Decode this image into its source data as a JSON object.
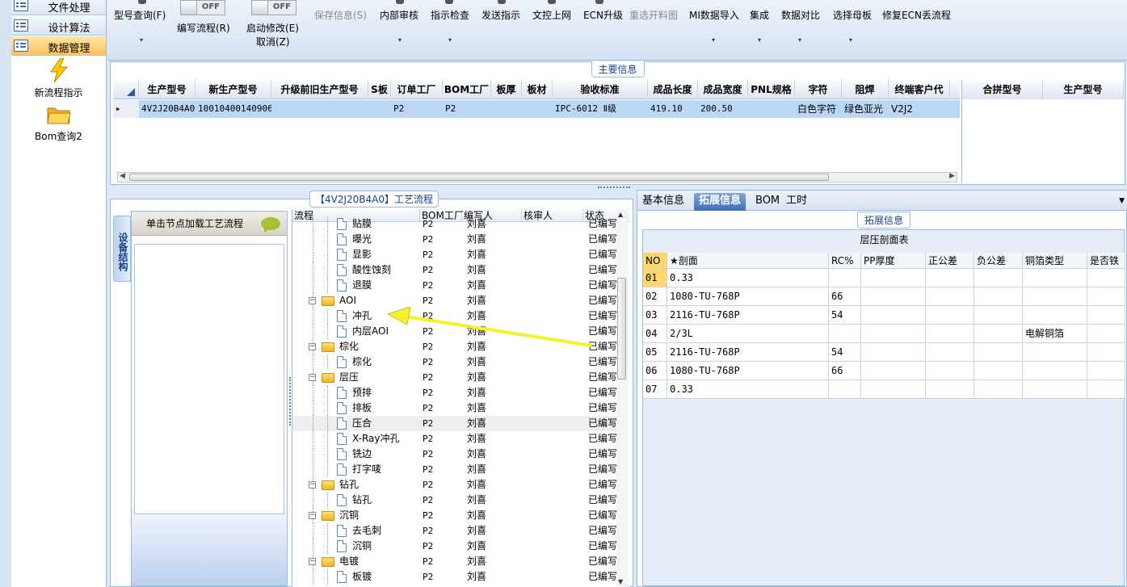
{
  "nav": {
    "items": [
      {
        "label": "文件处理",
        "active": false
      },
      {
        "label": "设计算法",
        "active": false
      },
      {
        "label": "数据管理",
        "active": true
      }
    ],
    "tools": [
      {
        "label": "新流程指示",
        "icon": "lightning-icon"
      },
      {
        "label": "Bom查询2",
        "icon": "folder-icon"
      }
    ]
  },
  "toolbar": {
    "model_query": "型号查询(F)",
    "write_flow": "编写流程(R)",
    "write_flow_toggle": "OFF",
    "start_modify": "启动修改(E)",
    "start_modify_toggle": "OFF",
    "cancel": "取消(Z)",
    "save_info": "保存信息(S)",
    "internal_review": "内部审核",
    "instruction_check": "指示检查",
    "send_instruction": "发送指示",
    "doc_control_online": "文控上网",
    "ecn_upgrade": "ECN升级",
    "reselect_cut_chart": "重选开料图",
    "mi_import": "MI数据导入",
    "integration": "集成",
    "data_compare": "数据对比",
    "select_master": "选择母板",
    "repair_ecn_flow": "修复ECN丢流程"
  },
  "main_info": {
    "title": "主要信息",
    "columns": [
      "生产型号",
      "新生产型号",
      "升级前旧生产型号",
      "S板",
      "订单工厂",
      "BOM工厂",
      "板厚",
      "板材",
      "验收标准",
      "成品长度",
      "成品宽度",
      "PNL规格",
      "字符",
      "阻焊",
      "终端客户代"
    ],
    "rows": [
      [
        "4V2J20B4A0",
        "10010400140906",
        "",
        "",
        "P2",
        "P2",
        "",
        "",
        "IPC-6012 Ⅱ级",
        "419.10",
        "200.50",
        "",
        "白色字符",
        "绿色亚光",
        "V2J2"
      ]
    ],
    "side_columns": [
      "合拼型号",
      "生产型号"
    ]
  },
  "flow": {
    "title": "【4V2J20B4A0】工艺流程",
    "vtab": "设备结构",
    "device_header": "单击节点加载工艺流程",
    "columns": [
      "流程",
      "BOM工厂",
      "编写人",
      "核审人",
      "状态"
    ],
    "rows": [
      {
        "name": "贴膜",
        "type": "doc",
        "bom": "P2",
        "writer": "刘喜",
        "reviewer": "",
        "status": "已编写"
      },
      {
        "name": "曝光",
        "type": "doc",
        "bom": "P2",
        "writer": "刘喜",
        "reviewer": "",
        "status": "已编写"
      },
      {
        "name": "显影",
        "type": "doc",
        "bom": "P2",
        "writer": "刘喜",
        "reviewer": "",
        "status": "已编写"
      },
      {
        "name": "酸性蚀刻",
        "type": "doc",
        "bom": "P2",
        "writer": "刘喜",
        "reviewer": "",
        "status": "已编写"
      },
      {
        "name": "退膜",
        "type": "doc",
        "bom": "P2",
        "writer": "刘喜",
        "reviewer": "",
        "status": "已编写"
      },
      {
        "name": "AOI",
        "type": "folder",
        "bom": "P2",
        "writer": "刘喜",
        "reviewer": "",
        "status": "已编写"
      },
      {
        "name": "冲孔",
        "type": "doc",
        "bom": "P2",
        "writer": "刘喜",
        "reviewer": "",
        "status": "已编写"
      },
      {
        "name": "内层AOI",
        "type": "doc",
        "bom": "P2",
        "writer": "刘喜",
        "reviewer": "",
        "status": "已编写"
      },
      {
        "name": "棕化",
        "type": "folder",
        "bom": "P2",
        "writer": "刘喜",
        "reviewer": "",
        "status": "已编写"
      },
      {
        "name": "棕化",
        "type": "doc",
        "bom": "P2",
        "writer": "刘喜",
        "reviewer": "",
        "status": "已编写"
      },
      {
        "name": "层压",
        "type": "folder",
        "bom": "P2",
        "writer": "刘喜",
        "reviewer": "",
        "status": "已编写"
      },
      {
        "name": "预排",
        "type": "doc",
        "bom": "P2",
        "writer": "刘喜",
        "reviewer": "",
        "status": "已编写"
      },
      {
        "name": "排板",
        "type": "doc",
        "bom": "P2",
        "writer": "刘喜",
        "reviewer": "",
        "status": "已编写"
      },
      {
        "name": "压合",
        "type": "doc",
        "bom": "P2",
        "writer": "刘喜",
        "reviewer": "",
        "status": "已编写",
        "selected": true
      },
      {
        "name": "X-Ray冲孔",
        "type": "doc",
        "bom": "P2",
        "writer": "刘喜",
        "reviewer": "",
        "status": "已编写"
      },
      {
        "name": "铣边",
        "type": "doc",
        "bom": "P2",
        "writer": "刘喜",
        "reviewer": "",
        "status": "已编写"
      },
      {
        "name": "打字唛",
        "type": "doc",
        "bom": "P2",
        "writer": "刘喜",
        "reviewer": "",
        "status": "已编写"
      },
      {
        "name": "钻孔",
        "type": "folder",
        "bom": "P2",
        "writer": "刘喜",
        "reviewer": "",
        "status": "已编写"
      },
      {
        "name": "钻孔",
        "type": "doc",
        "bom": "P2",
        "writer": "刘喜",
        "reviewer": "",
        "status": "已编写"
      },
      {
        "name": "沉铜",
        "type": "folder",
        "bom": "P2",
        "writer": "刘喜",
        "reviewer": "",
        "status": "已编写"
      },
      {
        "name": "去毛刺",
        "type": "doc",
        "bom": "P2",
        "writer": "刘喜",
        "reviewer": "",
        "status": "已编写"
      },
      {
        "name": "沉铜",
        "type": "doc",
        "bom": "P2",
        "writer": "刘喜",
        "reviewer": "",
        "status": "已编写"
      },
      {
        "name": "电镀",
        "type": "folder",
        "bom": "P2",
        "writer": "刘喜",
        "reviewer": "",
        "status": "已编写"
      },
      {
        "name": "板镀",
        "type": "doc",
        "bom": "P2",
        "writer": "刘喜",
        "reviewer": "",
        "status": "已编写"
      }
    ]
  },
  "right": {
    "tabs": [
      "基本信息",
      "拓展信息",
      "BOM",
      "工时"
    ],
    "active_tab": 1,
    "ext_title": "拓展信息",
    "stack_title": "层压剖面表",
    "columns": [
      "NO",
      "★剖面",
      "RC%",
      "PP厚度",
      "正公差",
      "负公差",
      "铜箔类型",
      "是否铁"
    ],
    "rows": [
      [
        "01",
        "0.33",
        "",
        "",
        "",
        "",
        "",
        ""
      ],
      [
        "02",
        "1080-TU-768P",
        "66",
        "",
        "",
        "",
        "",
        ""
      ],
      [
        "03",
        "2116-TU-768P",
        "54",
        "",
        "",
        "",
        "",
        ""
      ],
      [
        "04",
        "2/3L",
        "",
        "",
        "",
        "",
        "电解铜箔",
        ""
      ],
      [
        "05",
        "2116-TU-768P",
        "54",
        "",
        "",
        "",
        "",
        ""
      ],
      [
        "06",
        "1080-TU-768P",
        "66",
        "",
        "",
        "",
        "",
        ""
      ],
      [
        "07",
        "0.33",
        "",
        "",
        "",
        "",
        "",
        ""
      ]
    ]
  },
  "colors": {
    "selection": "#bcd7f3",
    "accent": "#ffd76b",
    "annotation_arrow": "#f4f22c"
  }
}
